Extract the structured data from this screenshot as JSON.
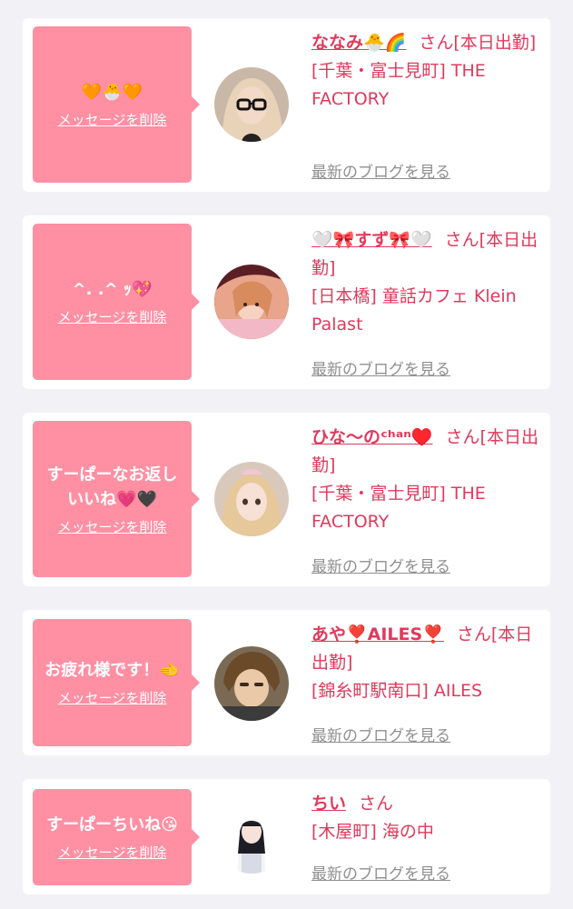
{
  "colors": {
    "bubble": "#ff8fa3",
    "accent": "#e0395c",
    "blog_link": "#8f8f8f",
    "background": "#f2f1f6"
  },
  "entries": [
    {
      "message": "🧡🐣🧡",
      "delete_label": "メッセージを削除",
      "name": "ななみ🐣🌈",
      "honorific": "さん",
      "status": "[本日出勤]",
      "shop": "[千葉・富士見町] THE FACTORY",
      "blog_label": "最新のブログを見る",
      "avatar_icon": "profile-photo"
    },
    {
      "message": "^. .^ ｯ💖",
      "delete_label": "メッセージを削除",
      "name": "🤍🎀すず🎀🤍",
      "honorific": "さん",
      "status": "[本日出勤]",
      "shop": "[日本橋] 童話カフェ Klein Palast",
      "blog_label": "最新のブログを見る",
      "avatar_icon": "profile-photo"
    },
    {
      "message": "すーぱーなお返しいいね💗🖤",
      "delete_label": "メッセージを削除",
      "name": "ひな〜のᶜʰᵃⁿ♥️",
      "honorific": "さん",
      "status": "[本日出勤]",
      "shop": "[千葉・富士見町] THE FACTORY",
      "blog_label": "最新のブログを見る",
      "avatar_icon": "profile-photo"
    },
    {
      "message": "お疲れ様です！🫲",
      "delete_label": "メッセージを削除",
      "name": "あや❣️AILES❣️",
      "honorific": "さん",
      "status": "[本日出勤]",
      "shop": "[錦糸町駅南口] AILES",
      "blog_label": "最新のブログを見る",
      "avatar_icon": "profile-photo"
    },
    {
      "message": "すーぱーちいね😘",
      "delete_label": "メッセージを削除",
      "name": "ちい",
      "honorific": "さん",
      "status": "",
      "shop": "[木屋町] 海の中",
      "blog_label": "最新のブログを見る",
      "avatar_icon": "profile-photo"
    }
  ]
}
